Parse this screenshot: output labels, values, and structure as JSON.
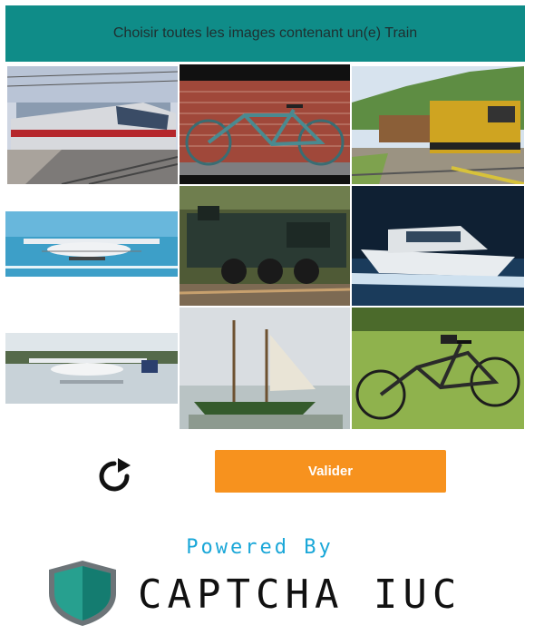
{
  "header": {
    "title": "Choisir toutes les images contenant un(e) Train"
  },
  "grid": {
    "tiles": [
      {
        "subject": "train"
      },
      {
        "subject": "bicycle"
      },
      {
        "subject": "train"
      },
      {
        "subject": "seaplane"
      },
      {
        "subject": "train"
      },
      {
        "subject": "boat"
      },
      {
        "subject": "seaplane"
      },
      {
        "subject": "sailboat"
      },
      {
        "subject": "bicycle"
      }
    ]
  },
  "actions": {
    "refresh_icon": "refresh-icon",
    "submit_label": "Valider"
  },
  "footer": {
    "powered_by": "Powered By",
    "brand": "CAPTCHA IUC",
    "logo_icon": "shield-icon"
  },
  "colors": {
    "header_bg": "#0f8c88",
    "button_bg": "#f7921e",
    "powered_text": "#1aa7d8"
  }
}
